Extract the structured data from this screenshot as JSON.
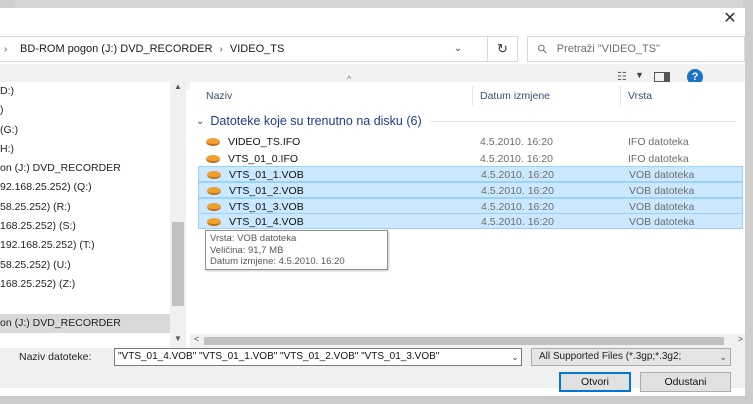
{
  "address": {
    "crumbs": [
      "BD-ROM pogon (J:) DVD_RECORDER",
      "VIDEO_TS"
    ],
    "search_placeholder": "Pretraži \"VIDEO_TS\""
  },
  "nav": {
    "items": [
      "D:)",
      ")",
      "(G:)",
      "H:)",
      "on (J:) DVD_RECORDER",
      "92.168.25.252) (Q:)",
      "58.25.252) (R:)",
      "168.25.252) (S:)",
      "192.168.25.252) (T:)",
      "58.25.252) (U:)",
      "168.25.252) (Z:)",
      "",
      "on (J:) DVD_RECORDER"
    ],
    "selected_index": 12
  },
  "columns": {
    "name": "Naziv",
    "date": "Datum izmjene",
    "type": "Vrsta"
  },
  "group": {
    "label": "Datoteke koje su trenutno na disku (6)"
  },
  "files": [
    {
      "name": "VIDEO_TS.IFO",
      "date": "4.5.2010. 16:20",
      "type": "IFO datoteka",
      "selected": false
    },
    {
      "name": "VTS_01_0.IFO",
      "date": "4.5.2010. 16:20",
      "type": "IFO datoteka",
      "selected": false
    },
    {
      "name": "VTS_01_1.VOB",
      "date": "4.5.2010. 16:20",
      "type": "VOB datoteka",
      "selected": true
    },
    {
      "name": "VTS_01_2.VOB",
      "date": "4.5.2010. 16:20",
      "type": "VOB datoteka",
      "selected": true
    },
    {
      "name": "VTS_01_3.VOB",
      "date": "4.5.2010. 16:20",
      "type": "VOB datoteka",
      "selected": true
    },
    {
      "name": "VTS_01_4.VOB",
      "date": "4.5.2010. 16:20",
      "type": "VOB datoteka",
      "selected": true
    }
  ],
  "tooltip": {
    "line1": "Vrsta: VOB datoteka",
    "line2": "Veličina: 91,7 MB",
    "line3": "Datum izmjene: 4.5.2010. 16:20"
  },
  "bottom": {
    "filename_label": "Naziv datoteke:",
    "filename_value": "\"VTS_01_4.VOB\" \"VTS_01_1.VOB\" \"VTS_01_2.VOB\" \"VTS_01_3.VOB\"",
    "filter_value": "All Supported Files (*.3gp;*.3g2;",
    "open_label": "Otvori",
    "cancel_label": "Odustani"
  },
  "icons": {
    "close": "close-icon",
    "refresh": "refresh-icon",
    "search": "search-icon",
    "view": "view-options-icon",
    "preview_pane": "preview-pane-icon",
    "help": "help-icon",
    "file": "disc-file-icon"
  },
  "colors": {
    "selection_bg": "#cce8ff",
    "selection_border": "#99d1ff",
    "group_text": "#1e3c8a",
    "primary_button_border": "#0078d7"
  }
}
